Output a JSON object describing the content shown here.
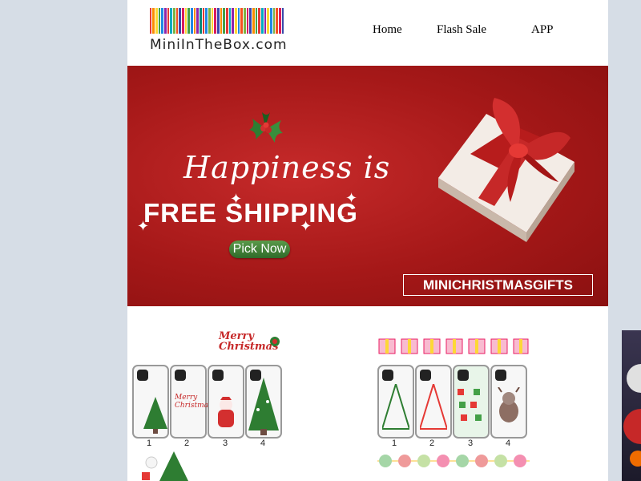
{
  "header": {
    "logo_text": "MiniInTheBox.com",
    "logo_colors": [
      "#e53935",
      "#fb8c00",
      "#fdd835",
      "#43a047",
      "#1e88e5",
      "#8e24aa",
      "#e53935",
      "#00acc1",
      "#7cb342",
      "#f4511e",
      "#3949ab",
      "#d81b60",
      "#fdd835",
      "#43a047",
      "#1e88e5",
      "#fb8c00",
      "#8e24aa",
      "#00897b",
      "#e53935",
      "#1e88e5",
      "#7cb342",
      "#fdd835",
      "#d81b60",
      "#3949ab",
      "#fb8c00",
      "#43a047",
      "#e53935",
      "#00acc1",
      "#8e24aa",
      "#fdd835",
      "#1e88e5",
      "#f4511e",
      "#7cb342",
      "#d81b60",
      "#3949ab",
      "#fb8c00",
      "#43a047",
      "#e53935",
      "#00acc1",
      "#8e24aa",
      "#fdd835",
      "#1e88e5",
      "#7cb342",
      "#f4511e",
      "#d81b60",
      "#3949ab"
    ],
    "nav": [
      {
        "label": "Home"
      },
      {
        "label": "Flash Sale"
      },
      {
        "label": "APP"
      }
    ]
  },
  "banner": {
    "headline": "Happiness is",
    "subheadline": "FREE SHIPPING",
    "cta_label": "Pick Now",
    "promo_code": "MINICHRISTMASGIFTS",
    "background_color": "#a51818"
  },
  "products": {
    "item1": {
      "labels": [
        "1",
        "2",
        "3",
        "4"
      ],
      "badge": "Merry Christmas"
    },
    "item2": {
      "labels": [
        "1",
        "2",
        "3",
        "4"
      ]
    }
  }
}
